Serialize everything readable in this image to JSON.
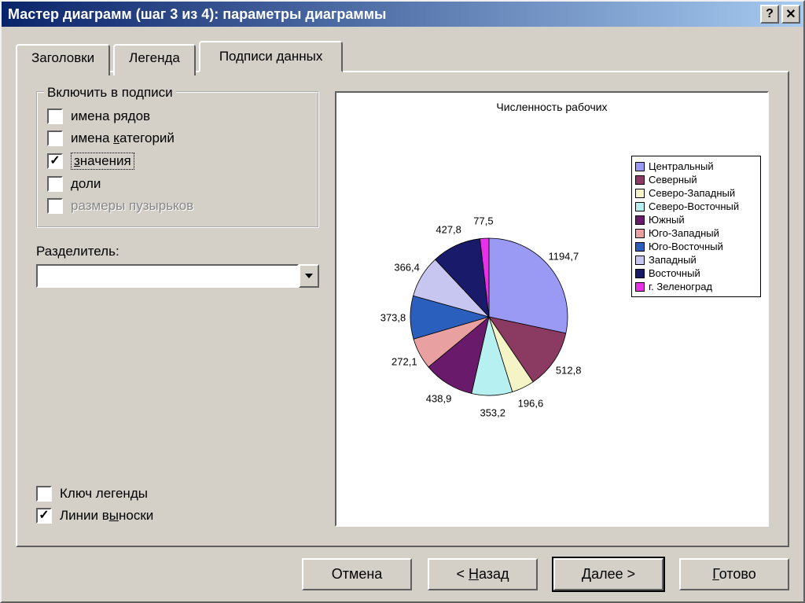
{
  "window": {
    "title": "Мастер диаграмм (шаг 3 из 4): параметры диаграммы"
  },
  "tabs": {
    "titles": "Заголовки",
    "legend": "Легенда",
    "data_labels": "Подписи данных"
  },
  "groupbox": {
    "legend": "Включить в подписи",
    "items": {
      "series": "имена рядов",
      "categories_pre": "имена ",
      "categories_u": "к",
      "categories_post": "атегорий",
      "values_u": "з",
      "values_post": "начения",
      "percent": "доли",
      "bubble": "размеры пузырьков"
    }
  },
  "separator": {
    "label_pre": "Раз",
    "label_u": "д",
    "label_post": "елитель:",
    "value": ""
  },
  "extra": {
    "legend_key": "Ключ легенды",
    "leader_pre": "Линии в",
    "leader_u": "ы",
    "leader_post": "носки"
  },
  "buttons": {
    "cancel": "Отмена",
    "back_pre": "< ",
    "back_u": "Н",
    "back_post": "азад",
    "next_pre": "",
    "next_u": "Д",
    "next_post": "алее >",
    "finish_u": "Г",
    "finish_post": "отово"
  },
  "chart_data": {
    "type": "pie",
    "title": "Численность рабочих",
    "series": [
      {
        "name": "Центральный",
        "value": 1194.7,
        "color": "#9a9af5"
      },
      {
        "name": "Северный",
        "value": 512.8,
        "color": "#8b3a62"
      },
      {
        "name": "Северо-Западный",
        "value": 196.6,
        "color": "#f4f4c6"
      },
      {
        "name": "Северо-Восточный",
        "value": 353.2,
        "color": "#b6f0f0"
      },
      {
        "name": "Южный",
        "value": 438.9,
        "color": "#6a1a6a"
      },
      {
        "name": "Юго-Западный",
        "value": 272.1,
        "color": "#e8a0a0"
      },
      {
        "name": "Юго-Восточный",
        "value": 373.8,
        "color": "#2a5fbd"
      },
      {
        "name": "Западный",
        "value": 366.4,
        "color": "#c6c6f0"
      },
      {
        "name": "Восточный",
        "value": 427.8,
        "color": "#1a1a6a"
      },
      {
        "name": "г. Зеленоград",
        "value": 77.5,
        "color": "#e830e8"
      }
    ]
  }
}
